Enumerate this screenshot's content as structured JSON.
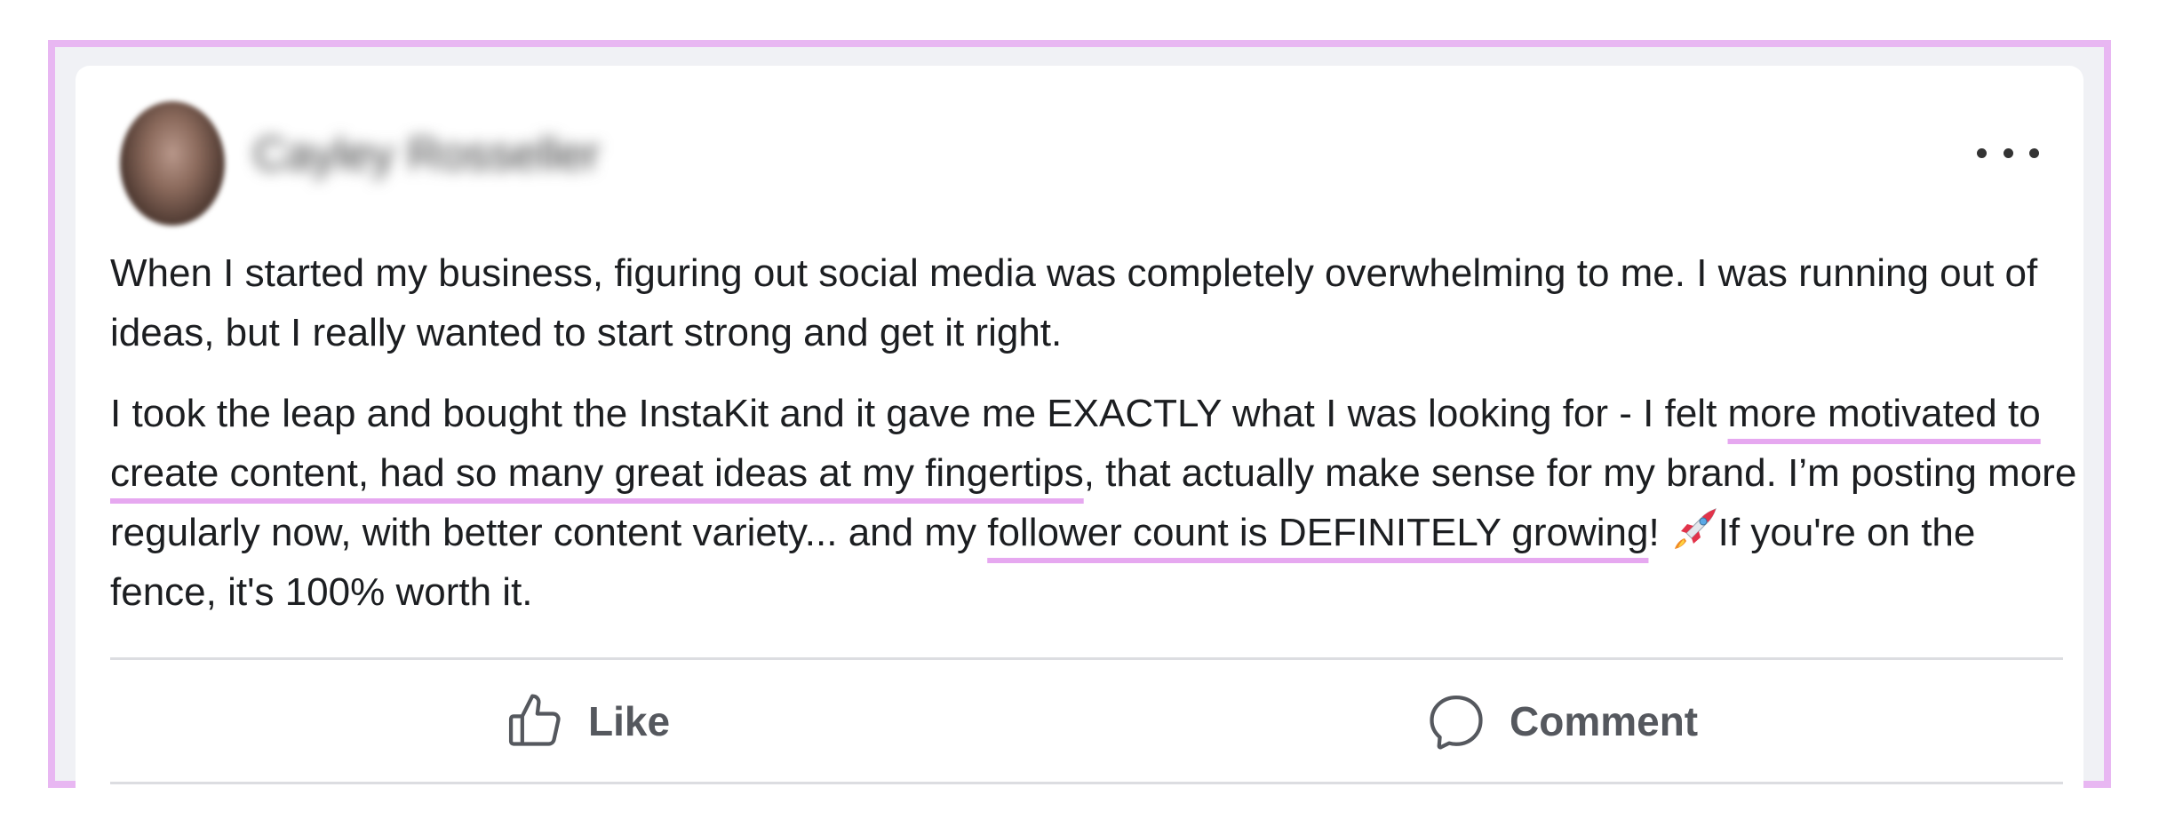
{
  "post": {
    "author_name": "Cayley Rosseller",
    "paragraphs": {
      "p1": "When I started my business, figuring out social media was completely overwhelming to me. I was running out of ideas, but I really wanted to start strong and get it right.",
      "p2_a": "I took the leap and bought the InstaKit and it gave me EXACTLY what I was looking for - I felt ",
      "p2_hl1": "more motivated to create content, had so many great ideas at my fingertips",
      "p2_b": ", that actually make sense for my brand. I’m posting more regularly now, with better content variety... and my ",
      "p2_hl2": "follower count is DEFINITELY growing",
      "p2_c": "!",
      "p2_d": "If you're on the fence, it's 100% worth it."
    }
  },
  "actions": {
    "like_label": "Like",
    "comment_label": "Comment"
  },
  "icons": {
    "more": "more-horizontal-icon",
    "like": "thumbs-up-icon",
    "comment": "comment-bubble-icon",
    "rocket": "rocket-emoji-icon"
  },
  "colors": {
    "frame_border": "#e8b7f2",
    "highlight_underline": "#e6a8f0",
    "text": "#1c1e21",
    "action_text": "#55585e"
  }
}
